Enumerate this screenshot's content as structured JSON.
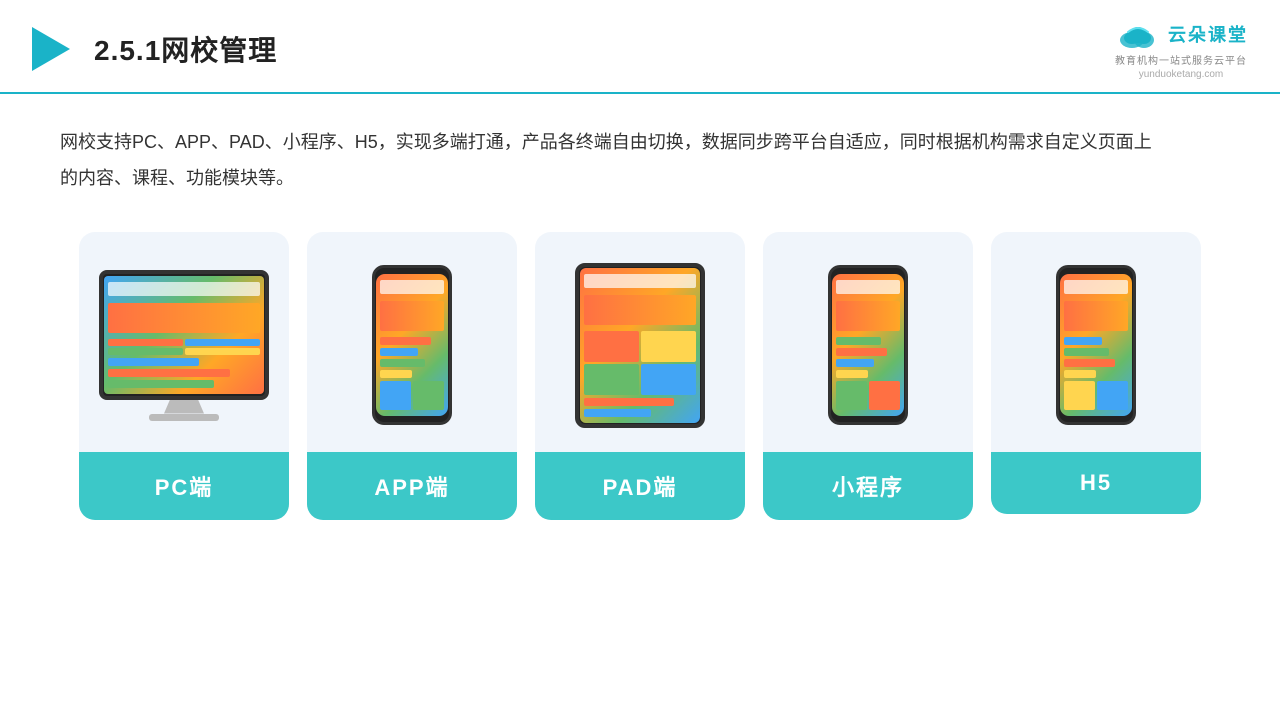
{
  "header": {
    "title": "2.5.1网校管理",
    "logo_text": "云朵课堂",
    "logo_sub": "教育机构一站式服务云平台",
    "logo_url": "yunduoketang.com"
  },
  "description": "网校支持PC、APP、PAD、小程序、H5，实现多端打通，产品各终端自由切换，数据同步跨平台自适应，同时根据机构需求自定义页面上的内容、课程、功能模块等。",
  "cards": [
    {
      "id": "pc",
      "label": "PC端",
      "type": "monitor"
    },
    {
      "id": "app",
      "label": "APP端",
      "type": "phone"
    },
    {
      "id": "pad",
      "label": "PAD端",
      "type": "tablet"
    },
    {
      "id": "miniprogram",
      "label": "小程序",
      "type": "phone"
    },
    {
      "id": "h5",
      "label": "H5",
      "type": "phone"
    }
  ]
}
